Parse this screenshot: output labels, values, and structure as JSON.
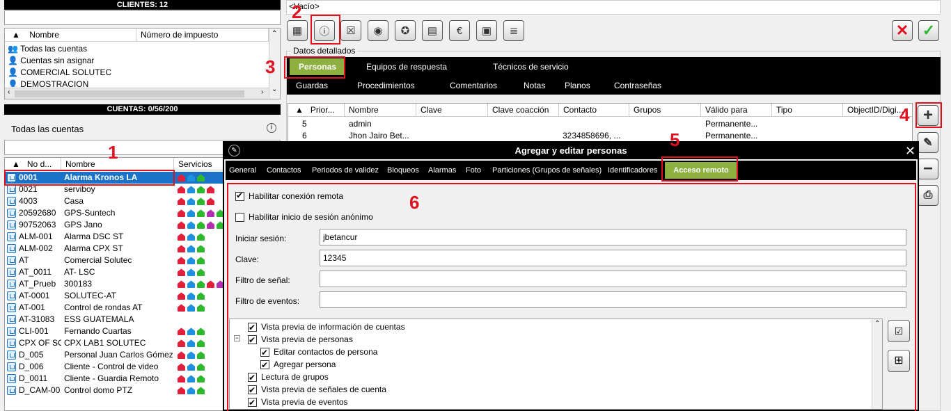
{
  "clients_panel": {
    "title": "CLIENTES: 12",
    "col_name": "Nombre",
    "col_tax": "Número de impuesto",
    "items": [
      "Todas las cuentas",
      "Cuentas sin asignar",
      "COMERCIAL SOLUTEC",
      "DEMOSTRACION"
    ]
  },
  "accounts_panel": {
    "title": "CUENTAS: 0/56/200",
    "filter_label": "Todas las cuentas",
    "info_icon": "info-icon",
    "col_no": "No d...",
    "col_name": "Nombre",
    "col_services": "Servicios",
    "rows": [
      {
        "no": "0001",
        "name": "Alarma Kronos LA",
        "svc": [
          "r",
          "b",
          "g"
        ]
      },
      {
        "no": "0021",
        "name": "serviboy",
        "svc": [
          "r",
          "b",
          "g",
          "r"
        ]
      },
      {
        "no": "4003",
        "name": "Casa",
        "svc": [
          "r",
          "b",
          "g",
          "r"
        ]
      },
      {
        "no": "20592680",
        "name": "GPS-Suntech",
        "svc": [
          "r",
          "b",
          "g",
          "p",
          "g"
        ]
      },
      {
        "no": "90752063",
        "name": "GPS Jano",
        "svc": [
          "r",
          "b",
          "g",
          "p",
          "g"
        ]
      },
      {
        "no": "ALM-001",
        "name": "Alarma DSC ST",
        "svc": [
          "r",
          "b",
          "g"
        ]
      },
      {
        "no": "ALM-002",
        "name": "Alarma CPX ST",
        "svc": [
          "r",
          "b",
          "g"
        ]
      },
      {
        "no": "AT",
        "name": "Comercial Solutec",
        "svc": [
          "r",
          "b",
          "g"
        ]
      },
      {
        "no": "AT_0011",
        "name": "AT- LSC",
        "svc": [
          "r",
          "b",
          "g"
        ]
      },
      {
        "no": "AT_Prueb",
        "name": "300183",
        "svc": [
          "r",
          "b",
          "g",
          "r",
          "p"
        ]
      },
      {
        "no": "AT-0001",
        "name": "SOLUTEC-AT",
        "svc": [
          "r",
          "b",
          "g"
        ]
      },
      {
        "no": "AT-001",
        "name": "Control de rondas AT",
        "svc": [
          "r",
          "b",
          "g"
        ]
      },
      {
        "no": "AT-31083",
        "name": "ESS GUATEMALA",
        "svc": []
      },
      {
        "no": "CLI-001",
        "name": "Fernando Cuartas",
        "svc": [
          "r",
          "b",
          "g"
        ]
      },
      {
        "no": "CPX OF SO",
        "name": "CPX LAB1 SOLUTEC",
        "svc": [
          "r",
          "b",
          "g"
        ]
      },
      {
        "no": "D_005",
        "name": "Personal Juan Carlos Gómez",
        "svc": [
          "r",
          "b",
          "g"
        ]
      },
      {
        "no": "D_006",
        "name": "Cliente - Control de video",
        "svc": [
          "r",
          "b",
          "g"
        ]
      },
      {
        "no": "D_0011",
        "name": "Cliente - Guardia Remoto",
        "svc": [
          "r",
          "b",
          "g"
        ]
      },
      {
        "no": "D_CAM-00",
        "name": "Control domo PTZ",
        "svc": [
          "r",
          "b",
          "g"
        ]
      }
    ]
  },
  "top_field": "<Vacío>",
  "details_label": "Datos detallados",
  "tabs_row1": [
    "Personas",
    "Equipos de respuesta",
    "Técnicos de servicio"
  ],
  "tabs_row2": [
    "Guardas",
    "Procedimientos",
    "Comentarios",
    "Notas",
    "Planos",
    "Contraseñas"
  ],
  "persons_table": {
    "headers": [
      "Prior...",
      "Nombre",
      "Clave",
      "Clave coacción",
      "Contacto",
      "Grupos",
      "Válido para",
      "Tipo",
      "ObjectID/Digi..."
    ],
    "rows": [
      {
        "prior": "5",
        "name": "admin",
        "clave": "",
        "coac": "",
        "contact": "",
        "groups": "",
        "valid": "Permanente...",
        "tipo": ""
      },
      {
        "prior": "6",
        "name": "Jhon Jairo Bet...",
        "clave": "",
        "coac": "",
        "contact": "3234858696, ...",
        "groups": "",
        "valid": "Permanente...",
        "tipo": ""
      }
    ]
  },
  "dialog": {
    "title": "Agregar y editar personas",
    "tabs": [
      "General",
      "Contactos",
      "Periodos de validez",
      "Bloqueos",
      "Alarmas",
      "Foto",
      "Particiones (Grupos de señales)",
      "Identificadores",
      "Acceso remoto"
    ],
    "enable_remote": "Habilitar conexión remota",
    "enable_anon": "Habilitar inicio de sesión anónimo",
    "login_label": "Iniciar sesión:",
    "login_value": "jbetancur",
    "password_label": "Clave:",
    "password_value": "12345",
    "signal_filter_label": "Filtro de señal:",
    "signal_filter_value": "",
    "event_filter_label": "Filtro de eventos:",
    "event_filter_value": "",
    "permissions": [
      {
        "label": "Vista previa de información de cuentas",
        "level": 0,
        "checked": true
      },
      {
        "label": "Vista previa de personas",
        "level": 0,
        "checked": true
      },
      {
        "label": "Editar contactos de persona",
        "level": 1,
        "checked": true
      },
      {
        "label": "Agregar persona",
        "level": 1,
        "checked": true
      },
      {
        "label": "Lectura de grupos",
        "level": 0,
        "checked": true
      },
      {
        "label": "Vista previa de señales de cuenta",
        "level": 0,
        "checked": true
      },
      {
        "label": "Vista previa de eventos",
        "level": 0,
        "checked": true
      }
    ]
  },
  "annotations": [
    "1",
    "2",
    "3",
    "4",
    "5",
    "6"
  ],
  "colors": {
    "accent_green": "#8db040",
    "selection_blue": "#1a73c8",
    "annotation_red": "#e01020"
  }
}
